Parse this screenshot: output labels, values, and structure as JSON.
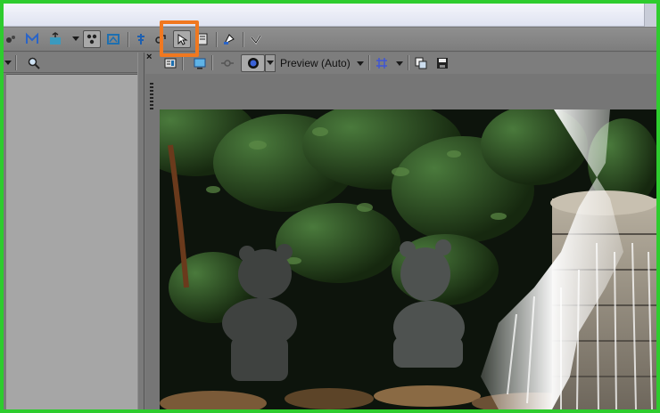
{
  "preview": {
    "quality_label": "Preview (Auto)",
    "close_glyph": "×"
  },
  "icons": {
    "toolbar": [
      "normalize-icon",
      "envelope-icon",
      "split-icon",
      "ripple-icon",
      "auto-crossfade-icon",
      "snap-icon",
      "enable-locking-icon",
      "lock-envelopes-icon",
      "normal-edit-tool-icon",
      "envelope-tool-icon",
      "selection-tool-icon",
      "brush-icon",
      "help-icon"
    ]
  },
  "colors": {
    "highlight": "#f07820",
    "screen_border": "#2ecc2e"
  }
}
